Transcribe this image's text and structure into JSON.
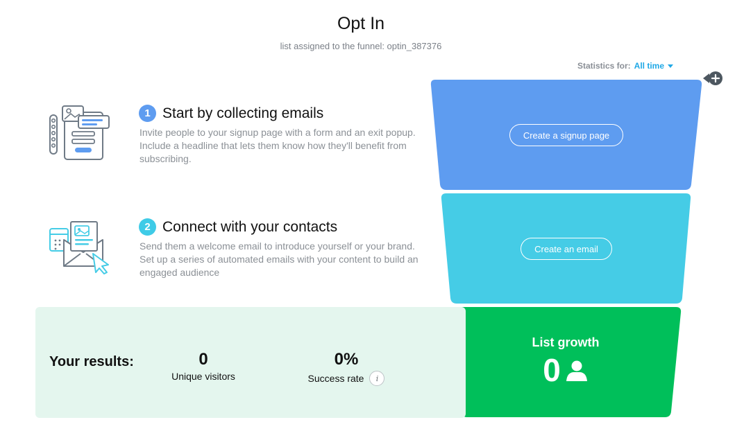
{
  "header": {
    "title": "Opt In",
    "subtitle": "list assigned to the funnel: optin_387376"
  },
  "stats": {
    "label": "Statistics for:",
    "range": "All time"
  },
  "steps": [
    {
      "number": "1",
      "title": "Start by collecting emails",
      "description": "Invite people to your signup page with a form and an exit popup. Include a headline that lets them know how they'll benefit from subscribing."
    },
    {
      "number": "2",
      "title": "Connect with your contacts",
      "description": "Send them a welcome email to introduce yourself or your brand. Set up a series of automated emails with your content to build an engaged audience"
    }
  ],
  "funnel": {
    "stage1_button": "Create a signup page",
    "stage2_button": "Create an email",
    "growth_title": "List growth",
    "growth_value": "0"
  },
  "results": {
    "label": "Your results:",
    "metrics": [
      {
        "value": "0",
        "label": "Unique visitors"
      },
      {
        "value": "0%",
        "label": "Success rate"
      }
    ]
  },
  "colors": {
    "stage1": "#5e9cf0",
    "stage2": "#45cce6",
    "stage3": "#00bf5a",
    "results_bg": "#e4f6ee",
    "accent_link": "#1fa8e6"
  },
  "icons": {
    "add": "plus-icon",
    "info": "info-icon",
    "user": "user-icon",
    "caret": "caret-down-icon"
  }
}
